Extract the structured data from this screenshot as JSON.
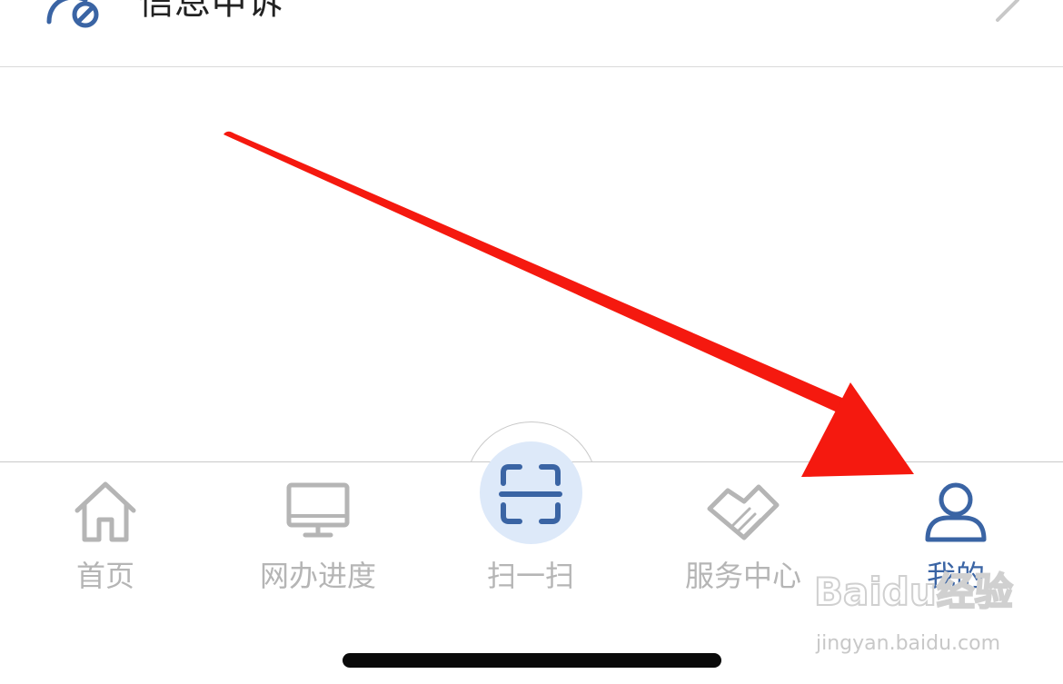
{
  "list": {
    "item_label": "信息申诉",
    "item_icon": "appeal-icon",
    "chevron_icon": "chevron-right-icon"
  },
  "tabbar": {
    "tabs": [
      {
        "label": "首页",
        "icon": "home-icon",
        "active": false
      },
      {
        "label": "网办进度",
        "icon": "monitor-icon",
        "active": false
      },
      {
        "label": "扫一扫",
        "icon": "scan-icon",
        "active": false
      },
      {
        "label": "服务中心",
        "icon": "handshake-icon",
        "active": false
      },
      {
        "label": "我的",
        "icon": "user-icon",
        "active": true
      }
    ]
  },
  "watermark": {
    "brand": "Baidu经验",
    "url": "jingyan.baidu.com"
  },
  "colors": {
    "accent": "#3a64a4",
    "inactive": "#b5b5b5",
    "scan_bg": "#dde9f9",
    "arrow": "#f5190f"
  }
}
